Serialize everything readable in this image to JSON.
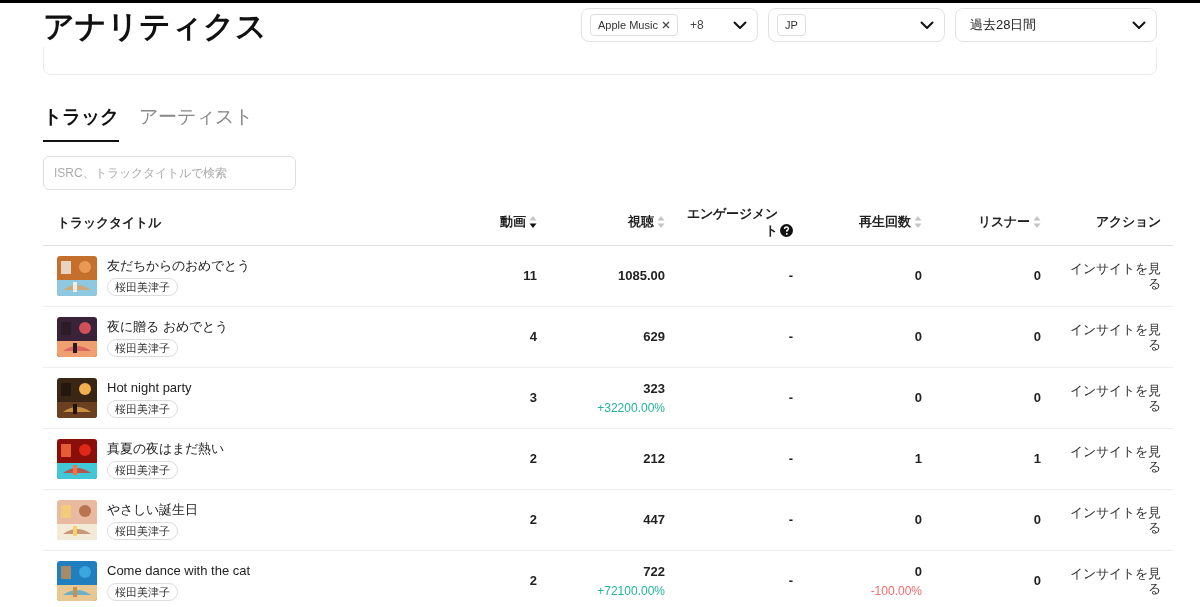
{
  "page_title": "アナリティクス",
  "filters": [
    {
      "kind": "chips",
      "chips": [
        "Apple Music"
      ],
      "removable": true,
      "more": "+8"
    },
    {
      "kind": "chips",
      "chips": [
        "JP"
      ],
      "removable": false
    },
    {
      "kind": "text",
      "value": "過去28日間"
    }
  ],
  "tabs": [
    {
      "label": "トラック",
      "selected": true
    },
    {
      "label": "アーティスト",
      "selected": false
    }
  ],
  "search": {
    "placeholder": "ISRC、トラックタイトルで検索"
  },
  "table": {
    "columns": [
      {
        "label": "トラックタイトル",
        "kind": "plain"
      },
      {
        "label": "動画",
        "kind": "sort",
        "sorted_descending": true
      },
      {
        "label": "視聴",
        "kind": "sort",
        "sorted_descending": false
      },
      {
        "label": "エンゲージメント",
        "kind": "help"
      },
      {
        "label": "再生回数",
        "kind": "sort",
        "sorted_descending": false
      },
      {
        "label": "リスナー",
        "kind": "sort",
        "sorted_descending": false
      },
      {
        "label": "アクション",
        "kind": "plain"
      }
    ],
    "rows": [
      {
        "title": "友だちからのおめでとう",
        "artist": "桜田美津子",
        "videos": "11",
        "views": {
          "value": "1085.00"
        },
        "engagement": "-",
        "plays": {
          "value": "0"
        },
        "listeners": "0",
        "action": "インサイトを見る"
      },
      {
        "title": "夜に贈る おめでとう",
        "artist": "桜田美津子",
        "videos": "4",
        "views": {
          "value": "629"
        },
        "engagement": "-",
        "plays": {
          "value": "0"
        },
        "listeners": "0",
        "action": "インサイトを見る"
      },
      {
        "title": "Hot night party",
        "artist": "桜田美津子",
        "videos": "3",
        "views": {
          "value": "323",
          "change": "+32200.00%",
          "increase": true
        },
        "engagement": "-",
        "plays": {
          "value": "0"
        },
        "listeners": "0",
        "action": "インサイトを見る"
      },
      {
        "title": "真夏の夜はまだ熱い",
        "artist": "桜田美津子",
        "videos": "2",
        "views": {
          "value": "212"
        },
        "engagement": "-",
        "plays": {
          "value": "1"
        },
        "listeners": "1",
        "action": "インサイトを見る"
      },
      {
        "title": "やさしい誕生日",
        "artist": "桜田美津子",
        "videos": "2",
        "views": {
          "value": "447"
        },
        "engagement": "-",
        "plays": {
          "value": "0"
        },
        "listeners": "0",
        "action": "インサイトを見る"
      },
      {
        "title": "Come dance with the cat",
        "artist": "桜田美津子",
        "videos": "2",
        "views": {
          "value": "722",
          "change": "+72100.00%",
          "increase": true
        },
        "engagement": "-",
        "plays": {
          "value": "0",
          "change": "-100.00%",
          "increase": false
        },
        "listeners": "0",
        "action": "インサイトを見る"
      }
    ]
  }
}
